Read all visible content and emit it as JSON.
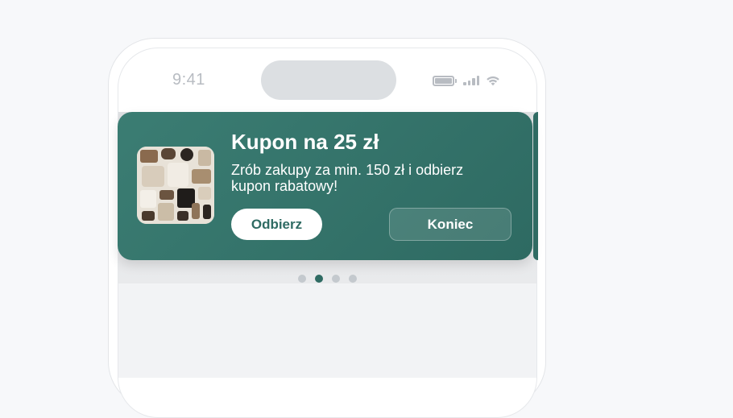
{
  "status_bar": {
    "time": "9:41",
    "icons": [
      "battery-icon",
      "signal-icon",
      "wifi-icon"
    ]
  },
  "banner": {
    "title": "Kupon na 25 zł",
    "description": "Zrób zakupy za min. 150 zł i odbierz kupon rabatowy!",
    "primary_button": "Odbierz",
    "secondary_button": "Koniec",
    "image": "clothing-flatlay-image"
  },
  "pagination": {
    "count": 4,
    "active_index": 1
  },
  "colors": {
    "accent": "#2f6b63",
    "card_bg": "#3b7d73",
    "page_bg": "#f7f8fa"
  }
}
